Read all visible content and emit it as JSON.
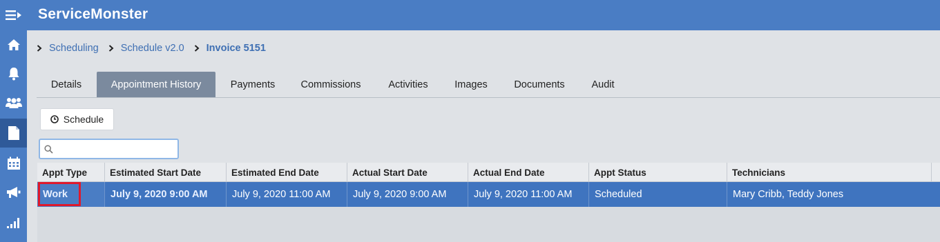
{
  "app": {
    "title": "ServiceMonster"
  },
  "sidebar": {
    "items": [
      {
        "icon": "home-icon"
      },
      {
        "icon": "bell-icon"
      },
      {
        "icon": "users-icon"
      },
      {
        "icon": "document-icon",
        "active": true
      },
      {
        "icon": "calendar-icon"
      },
      {
        "icon": "megaphone-icon"
      },
      {
        "icon": "signal-bars-icon"
      }
    ]
  },
  "breadcrumb": {
    "items": [
      "Scheduling",
      "Schedule v2.0"
    ],
    "current": "Invoice 5151"
  },
  "tabs": [
    {
      "label": "Details"
    },
    {
      "label": "Appointment History",
      "active": true
    },
    {
      "label": "Payments"
    },
    {
      "label": "Commissions"
    },
    {
      "label": "Activities"
    },
    {
      "label": "Images"
    },
    {
      "label": "Documents"
    },
    {
      "label": "Audit"
    }
  ],
  "toolbar": {
    "schedule_label": "Schedule"
  },
  "search": {
    "value": "",
    "placeholder": ""
  },
  "table": {
    "columns": [
      "Appt Type",
      "Estimated Start Date",
      "Estimated End Date",
      "Actual Start Date",
      "Actual End Date",
      "Appt Status",
      "Technicians"
    ],
    "rows": [
      [
        "Work",
        "July 9, 2020 9:00 AM",
        "July 9, 2020 11:00 AM",
        "July 9, 2020 9:00 AM",
        "July 9, 2020 11:00 AM",
        "Scheduled",
        "Mary Cribb, Teddy Jones"
      ]
    ]
  },
  "colors": {
    "brand": "#4a7dc4",
    "selected_row": "#3f74bf",
    "highlight": "#e0192b",
    "link": "#3e6fb3"
  }
}
